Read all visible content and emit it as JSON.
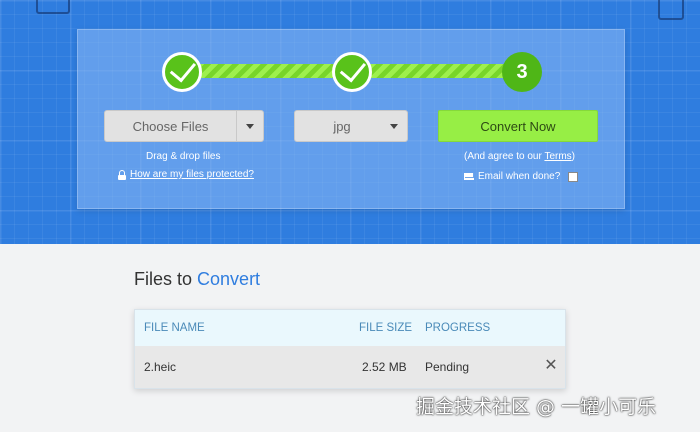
{
  "steps": {
    "step1_state": "complete",
    "step2_state": "complete",
    "step3_label": "3",
    "accent_color": "#59c21a"
  },
  "upload": {
    "choose_files_label": "Choose Files",
    "drag_drop_hint": "Drag & drop files",
    "protected_link": "How are my files protected?"
  },
  "format": {
    "selected": "jpg"
  },
  "convert": {
    "button_label": "Convert Now",
    "agree_prefix": "(And agree to our ",
    "terms_link": "Terms",
    "agree_suffix": ")",
    "email_label": "Email when done?",
    "email_checked": false
  },
  "files": {
    "title_prefix": "Files to ",
    "title_accent": "Convert",
    "columns": {
      "name": "FILE NAME",
      "size": "FILE SIZE",
      "progress": "PROGRESS"
    },
    "rows": [
      {
        "name": "2.heic",
        "size": "2.52 MB",
        "progress": "Pending"
      }
    ]
  },
  "watermark": "掘金技术社区 @ 一罐小可乐",
  "colors": {
    "hero_blue": "#2f7ddf",
    "convert_green": "#97ee45",
    "table_header_bg": "#eaf8fd"
  }
}
